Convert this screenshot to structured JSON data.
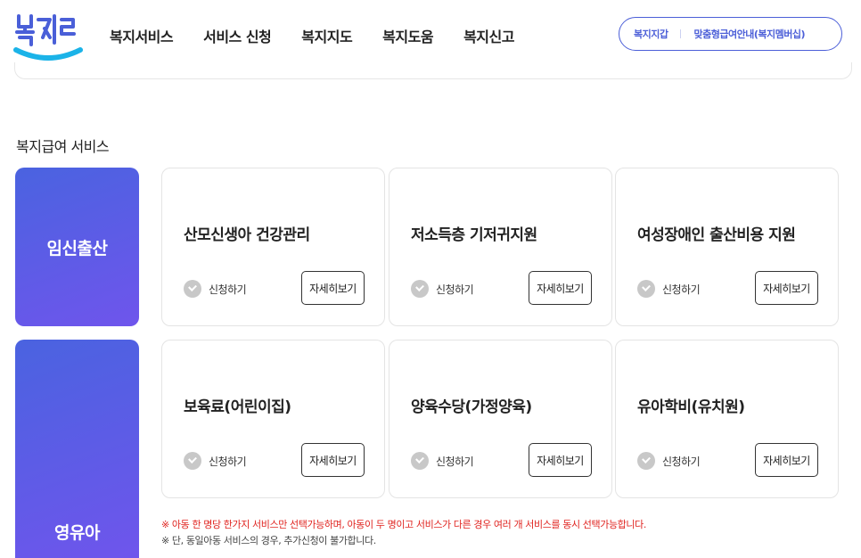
{
  "header": {
    "logo_text": "복지로",
    "nav": [
      "복지서비스",
      "서비스 신청",
      "복지지도",
      "복지도움",
      "복지신고"
    ],
    "util_links": [
      "복지지갑",
      "맞춤형급여안내(복지멤버십)"
    ]
  },
  "section_title": "복지급여 서비스",
  "categories": [
    {
      "label": "임신출산",
      "services": [
        {
          "title": "산모신생아 건강관리",
          "apply": "신청하기",
          "detail": "자세히보기"
        },
        {
          "title": "저소득층 기저귀지원",
          "apply": "신청하기",
          "detail": "자세히보기"
        },
        {
          "title": "여성장애인 출산비용 지원",
          "apply": "신청하기",
          "detail": "자세히보기"
        }
      ]
    },
    {
      "label": "영유아",
      "services": [
        {
          "title": "보육료(어린이집)",
          "apply": "신청하기",
          "detail": "자세히보기"
        },
        {
          "title": "양육수당(가정양육)",
          "apply": "신청하기",
          "detail": "자세히보기"
        },
        {
          "title": "유아학비(유치원)",
          "apply": "신청하기",
          "detail": "자세히보기"
        }
      ]
    }
  ],
  "notes": [
    "※ 아동 한 명당 한가지 서비스만 선택가능하며, 아동이 두 명이고 서비스가 다른 경우 여러 개 서비스를 동시 선택가능합니다.",
    "※ 단, 동일아동 서비스의 경우, 추가신청이 불가합니다."
  ],
  "colors": {
    "brand": "#4c5fd8",
    "gradient_start": "#4a63e0",
    "gradient_end": "#6f55ec",
    "note_red": "#e0231f",
    "logo_cyan": "#1bb3e8"
  },
  "icons": {
    "apply": "check-circle-icon"
  }
}
